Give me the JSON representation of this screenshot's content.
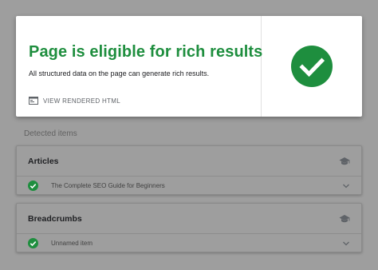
{
  "result": {
    "title": "Page is eligible for rich results",
    "subtitle": "All structured data on the page can generate rich results.",
    "view_html_label": "VIEW RENDERED HTML",
    "status_icon": "check-circle-icon",
    "status_color": "#1e8e3e"
  },
  "detected": {
    "label": "Detected items",
    "items": [
      {
        "title": "Articles",
        "icon": "school-cap-icon",
        "rows": [
          {
            "label": "The Complete SEO Guide for Beginners",
            "status": "valid"
          }
        ]
      },
      {
        "title": "Breadcrumbs",
        "icon": "school-cap-icon",
        "rows": [
          {
            "label": "Unnamed item",
            "status": "valid"
          }
        ]
      }
    ]
  },
  "colors": {
    "overlay": "#9e9e9e",
    "valid_green": "#1e8e3e",
    "card_bg": "#ffffff"
  }
}
